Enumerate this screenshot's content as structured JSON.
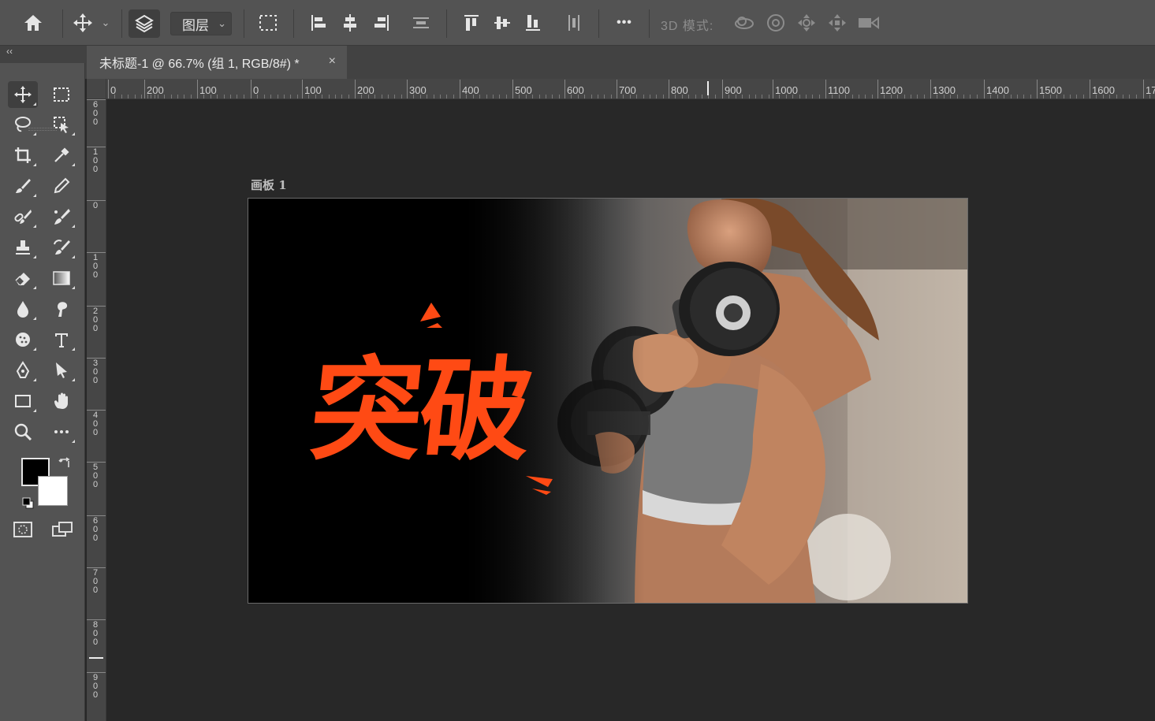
{
  "options_bar": {
    "home_icon": "home-icon",
    "move_tool_icon": "move-arrows-icon",
    "auto_select_icon": "layers-stack-icon",
    "auto_select_target": "图层",
    "mode_3d_label": "3D 模式:",
    "more_label": "•••"
  },
  "document_tab": {
    "title": "未标题-1 @ 66.7% (组 1, RGB/8#) *",
    "close_label": "×"
  },
  "panel_collapse_label": "‹‹",
  "ruler_top_labels": [
    "0",
    "200",
    "100",
    "0",
    "100",
    "200",
    "300",
    "400",
    "500",
    "600",
    "700",
    "800",
    "900",
    "1000",
    "1100",
    "1200",
    "1300",
    "1400",
    "1500",
    "1600",
    "17"
  ],
  "ruler_left_labels": [
    "600",
    "100",
    "0",
    "100",
    "200",
    "300",
    "400",
    "500",
    "600",
    "700",
    "800",
    "900"
  ],
  "artboard": {
    "name": "画板 1",
    "headline": "突破"
  },
  "colors": {
    "accent_text": "#ff4a14",
    "foreground_swatch": "#000000",
    "background_swatch": "#ffffff",
    "app_background": "#282828",
    "panel": "#535353"
  },
  "tools": [
    "move-tool",
    "marquee-tool",
    "lasso-tool",
    "object-select-tool",
    "crop-tool",
    "eyedropper-tool",
    "brush-tool",
    "pencil-tool",
    "healing-brush-tool",
    "mixer-brush-tool",
    "clone-stamp-tool",
    "history-brush-tool",
    "eraser-tool",
    "gradient-tool",
    "blur-tool",
    "smudge-tool",
    "sponge-tool",
    "type-tool",
    "pen-tool",
    "path-select-tool",
    "rectangle-tool",
    "hand-tool",
    "zoom-tool",
    "more-tools"
  ]
}
